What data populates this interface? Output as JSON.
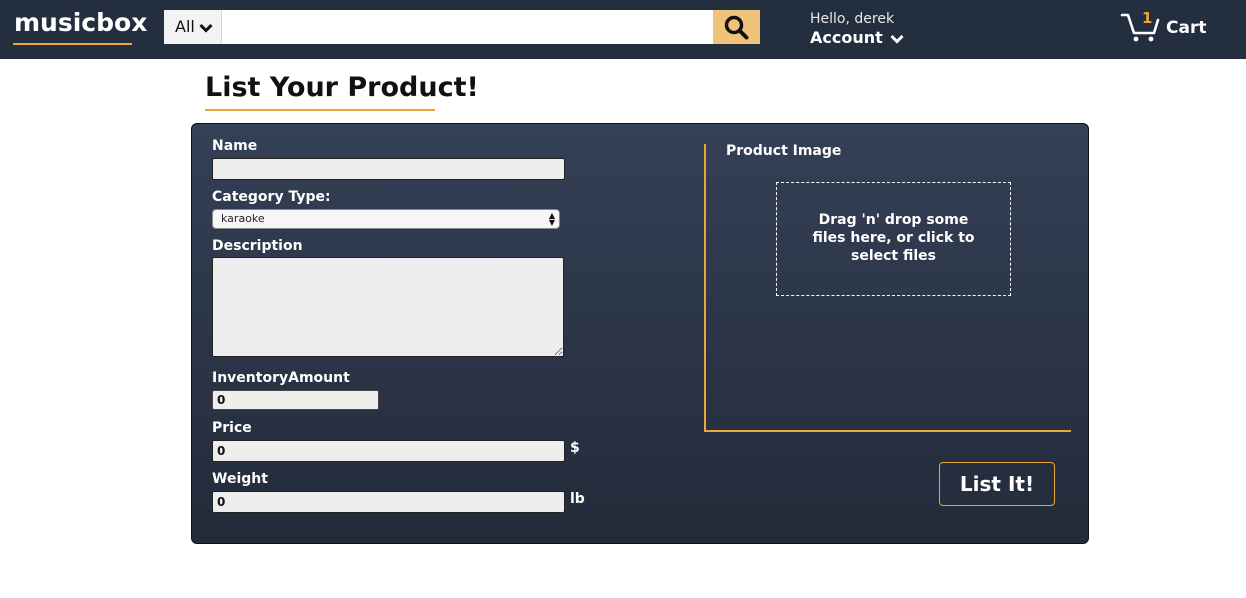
{
  "header": {
    "logo": "musicbox",
    "search": {
      "category": "All",
      "placeholder": "",
      "value": ""
    },
    "account": {
      "greeting": "Hello, derek",
      "label": "Account"
    },
    "cart": {
      "count": "1",
      "label": "Cart"
    }
  },
  "page": {
    "title": "List Your Product!"
  },
  "form": {
    "name": {
      "label": "Name",
      "value": ""
    },
    "category": {
      "label": "Category Type:",
      "selected": "karaoke"
    },
    "description": {
      "label": "Description",
      "value": ""
    },
    "inventory": {
      "label": "InventoryAmount",
      "value": "0"
    },
    "price": {
      "label": "Price",
      "value": "0",
      "unit": "$"
    },
    "weight": {
      "label": "Weight",
      "value": "0",
      "unit": "lb"
    },
    "image": {
      "label": "Product Image",
      "dropzone_text": "Drag 'n' drop some files here, or click to select files"
    },
    "submit_label": "List It!"
  },
  "colors": {
    "navbar": "#232f3e",
    "accent": "#f0a33a",
    "search_button": "#f0c27a"
  },
  "icons": [
    "search-icon",
    "chevron-down-icon",
    "cart-icon"
  ]
}
